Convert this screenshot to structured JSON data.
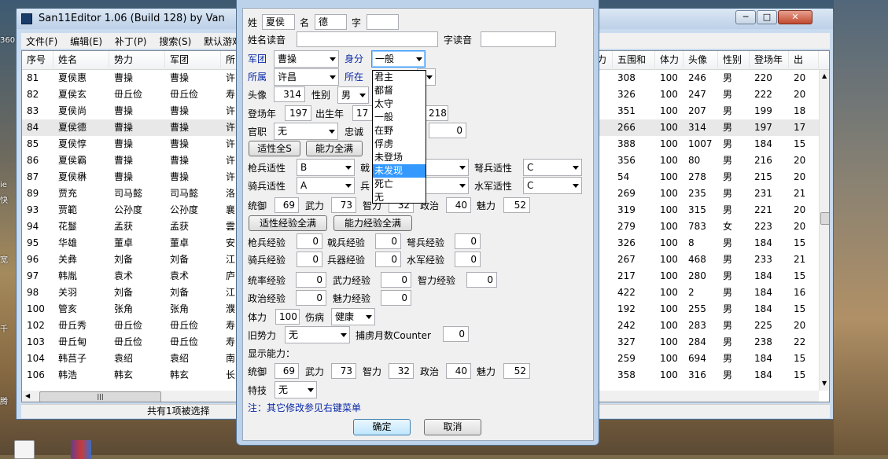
{
  "main": {
    "title": "San11Editor 1.06 (Build 128) by Van",
    "menu": [
      "文件(F)",
      "编辑(E)",
      "补丁(P)",
      "搜索(S)",
      "默认游戏设"
    ],
    "columns_left": [
      "序号",
      "姓名",
      "势力",
      "军团",
      "所"
    ],
    "columns_right": [
      "力",
      "五围和",
      "体力",
      "头像",
      "性别",
      "登场年",
      "出"
    ],
    "rows": [
      {
        "no": "81",
        "name": "夏侯惠",
        "faction": "曹操",
        "army": "曹操",
        "loc": "许",
        "r": "",
        "sum": "308",
        "hp": "100",
        "face": "246",
        "sex": "男",
        "year": "220",
        "birth": "20"
      },
      {
        "no": "82",
        "name": "夏侯玄",
        "faction": "毌丘俭",
        "army": "毌丘俭",
        "loc": "寿",
        "r": "",
        "sum": "326",
        "hp": "100",
        "face": "247",
        "sex": "男",
        "year": "222",
        "birth": "20"
      },
      {
        "no": "83",
        "name": "夏侯尚",
        "faction": "曹操",
        "army": "曹操",
        "loc": "许",
        "r": "",
        "sum": "351",
        "hp": "100",
        "face": "207",
        "sex": "男",
        "year": "199",
        "birth": "18"
      },
      {
        "no": "84",
        "name": "夏侯德",
        "faction": "曹操",
        "army": "曹操",
        "loc": "许",
        "r": "",
        "sum": "266",
        "hp": "100",
        "face": "314",
        "sex": "男",
        "year": "197",
        "birth": "17"
      },
      {
        "no": "85",
        "name": "夏侯惇",
        "faction": "曹操",
        "army": "曹操",
        "loc": "许",
        "r": "",
        "sum": "388",
        "hp": "100",
        "face": "1007",
        "sex": "男",
        "year": "184",
        "birth": "15"
      },
      {
        "no": "86",
        "name": "夏侯霸",
        "faction": "曹操",
        "army": "曹操",
        "loc": "许",
        "r": "",
        "sum": "356",
        "hp": "100",
        "face": "80",
        "sex": "男",
        "year": "216",
        "birth": "20"
      },
      {
        "no": "87",
        "name": "夏侯楙",
        "faction": "曹操",
        "army": "曹操",
        "loc": "许",
        "r": "",
        "sum": "54",
        "hp": "100",
        "face": "278",
        "sex": "男",
        "year": "215",
        "birth": "20"
      },
      {
        "no": "89",
        "name": "贾充",
        "faction": "司马懿",
        "army": "司马懿",
        "loc": "洛",
        "r": "",
        "sum": "269",
        "hp": "100",
        "face": "235",
        "sex": "男",
        "year": "231",
        "birth": "21"
      },
      {
        "no": "93",
        "name": "贾範",
        "faction": "公孙度",
        "army": "公孙度",
        "loc": "襄",
        "r": "",
        "sum": "319",
        "hp": "100",
        "face": "315",
        "sex": "男",
        "year": "221",
        "birth": "20"
      },
      {
        "no": "94",
        "name": "花鬘",
        "faction": "孟获",
        "army": "孟获",
        "loc": "雲",
        "r": "",
        "sum": "279",
        "hp": "100",
        "face": "783",
        "sex": "女",
        "year": "223",
        "birth": "20"
      },
      {
        "no": "95",
        "name": "华雄",
        "faction": "董卓",
        "army": "董卓",
        "loc": "安",
        "r": "",
        "sum": "326",
        "hp": "100",
        "face": "8",
        "sex": "男",
        "year": "184",
        "birth": "15"
      },
      {
        "no": "96",
        "name": "关彝",
        "faction": "刘备",
        "army": "刘备",
        "loc": "江",
        "r": "",
        "sum": "267",
        "hp": "100",
        "face": "468",
        "sex": "男",
        "year": "233",
        "birth": "21"
      },
      {
        "no": "97",
        "name": "韩胤",
        "faction": "袁术",
        "army": "袁术",
        "loc": "庐",
        "r": "",
        "sum": "217",
        "hp": "100",
        "face": "280",
        "sex": "男",
        "year": "184",
        "birth": "15"
      },
      {
        "no": "98",
        "name": "关羽",
        "faction": "刘备",
        "army": "刘备",
        "loc": "江",
        "r": "",
        "sum": "422",
        "hp": "100",
        "face": "2",
        "sex": "男",
        "year": "184",
        "birth": "16"
      },
      {
        "no": "100",
        "name": "管亥",
        "faction": "张角",
        "army": "张角",
        "loc": "濮",
        "r": "",
        "sum": "192",
        "hp": "100",
        "face": "255",
        "sex": "男",
        "year": "184",
        "birth": "15"
      },
      {
        "no": "102",
        "name": "毌丘秀",
        "faction": "毌丘俭",
        "army": "毌丘俭",
        "loc": "寿",
        "r": "",
        "sum": "242",
        "hp": "100",
        "face": "283",
        "sex": "男",
        "year": "225",
        "birth": "20"
      },
      {
        "no": "103",
        "name": "毌丘甸",
        "faction": "毌丘俭",
        "army": "毌丘俭",
        "loc": "寿",
        "r": "",
        "sum": "327",
        "hp": "100",
        "face": "284",
        "sex": "男",
        "year": "238",
        "birth": "22"
      },
      {
        "no": "104",
        "name": "韩莒子",
        "faction": "袁绍",
        "army": "袁绍",
        "loc": "南",
        "r": "",
        "sum": "259",
        "hp": "100",
        "face": "694",
        "sex": "男",
        "year": "184",
        "birth": "15"
      },
      {
        "no": "106",
        "name": "韩浩",
        "faction": "韩玄",
        "army": "韩玄",
        "loc": "长",
        "r": "",
        "sum": "358",
        "hp": "100",
        "face": "316",
        "sex": "男",
        "year": "184",
        "birth": "15"
      }
    ],
    "status": "共有1项被选择",
    "hscroll_grip": "|||"
  },
  "dialog": {
    "title": "",
    "l_surname": "姓",
    "surname": "夏侯",
    "l_given": "名",
    "given": "德",
    "l_style": "字",
    "style": "",
    "l_name_read": "姓名读音",
    "name_read": "",
    "l_style_read": "字读音",
    "style_read": "",
    "l_army": "军团",
    "army": "曹操",
    "l_status": "身分",
    "status_val": "一般",
    "l_belong": "所属",
    "belong": "许昌",
    "l_loc": "所在",
    "l_face": "头像",
    "face": "314",
    "l_sex": "性别",
    "sex": "男",
    "l_appear": "登场年",
    "appear": "197",
    "l_born": "出生年",
    "born": "17",
    "death": "218",
    "l_office": "官职",
    "office": "无",
    "l_loyal": "忠诚",
    "loyal": "0",
    "btn_apt_s": "适性全S",
    "btn_ability_full": "能力全满",
    "l_spear": "枪兵适性",
    "spear": "B",
    "l_halberd": "戟",
    "l_crossbow": "弩兵适性",
    "crossbow": "C",
    "l_cavalry": "骑兵适性",
    "cavalry": "A",
    "l_weapon": "兵",
    "l_navy": "水军适性",
    "navy": "C",
    "l_lead": "统御",
    "lead": "69",
    "l_war": "武力",
    "war": "73",
    "l_int": "智力",
    "int": "32",
    "l_pol": "政治",
    "pol": "40",
    "l_chr": "魅力",
    "chr": "52",
    "btn_apt_exp": "适性经验全满",
    "btn_abil_exp": "能力经验全满",
    "l_spear_exp": "枪兵经验",
    "spear_exp": "0",
    "l_halberd_exp": "戟兵经验",
    "halberd_exp": "0",
    "l_crossbow_exp": "弩兵经验",
    "crossbow_exp": "0",
    "l_cavalry_exp": "骑兵经验",
    "cavalry_exp": "0",
    "l_weapon_exp": "兵器经验",
    "weapon_exp": "0",
    "l_navy_exp": "水军经验",
    "navy_exp": "0",
    "l_lead_exp": "统率经验",
    "lead_exp": "0",
    "l_war_exp": "武力经验",
    "war_exp": "0",
    "l_int_exp": "智力经验",
    "int_exp": "0",
    "l_pol_exp": "政治经验",
    "pol_exp": "0",
    "l_chr_exp": "魅力经验",
    "chr_exp": "0",
    "l_hp": "体力",
    "hp": "100",
    "l_injury": "伤病",
    "injury": "健康",
    "l_old_faction": "旧势力",
    "old_faction": "无",
    "l_captive": "捕虏月数Counter",
    "captive": "0",
    "l_display": "显示能力：",
    "d_lead": "69",
    "d_war": "73",
    "d_int": "32",
    "d_pol": "40",
    "d_chr": "52",
    "l_skill": "特技",
    "skill": "无",
    "note": "注：其它修改参见右键菜单",
    "ok": "确定",
    "cancel": "取消",
    "status_options": [
      "君主",
      "都督",
      "太守",
      "一般",
      "在野",
      "俘虏",
      "未登场",
      "未发现",
      "死亡",
      "无"
    ],
    "status_highlight": 7
  },
  "desktop": {
    "icon_labels": [
      "360",
      "ie",
      "快",
      "宽",
      "千",
      "腾"
    ]
  }
}
